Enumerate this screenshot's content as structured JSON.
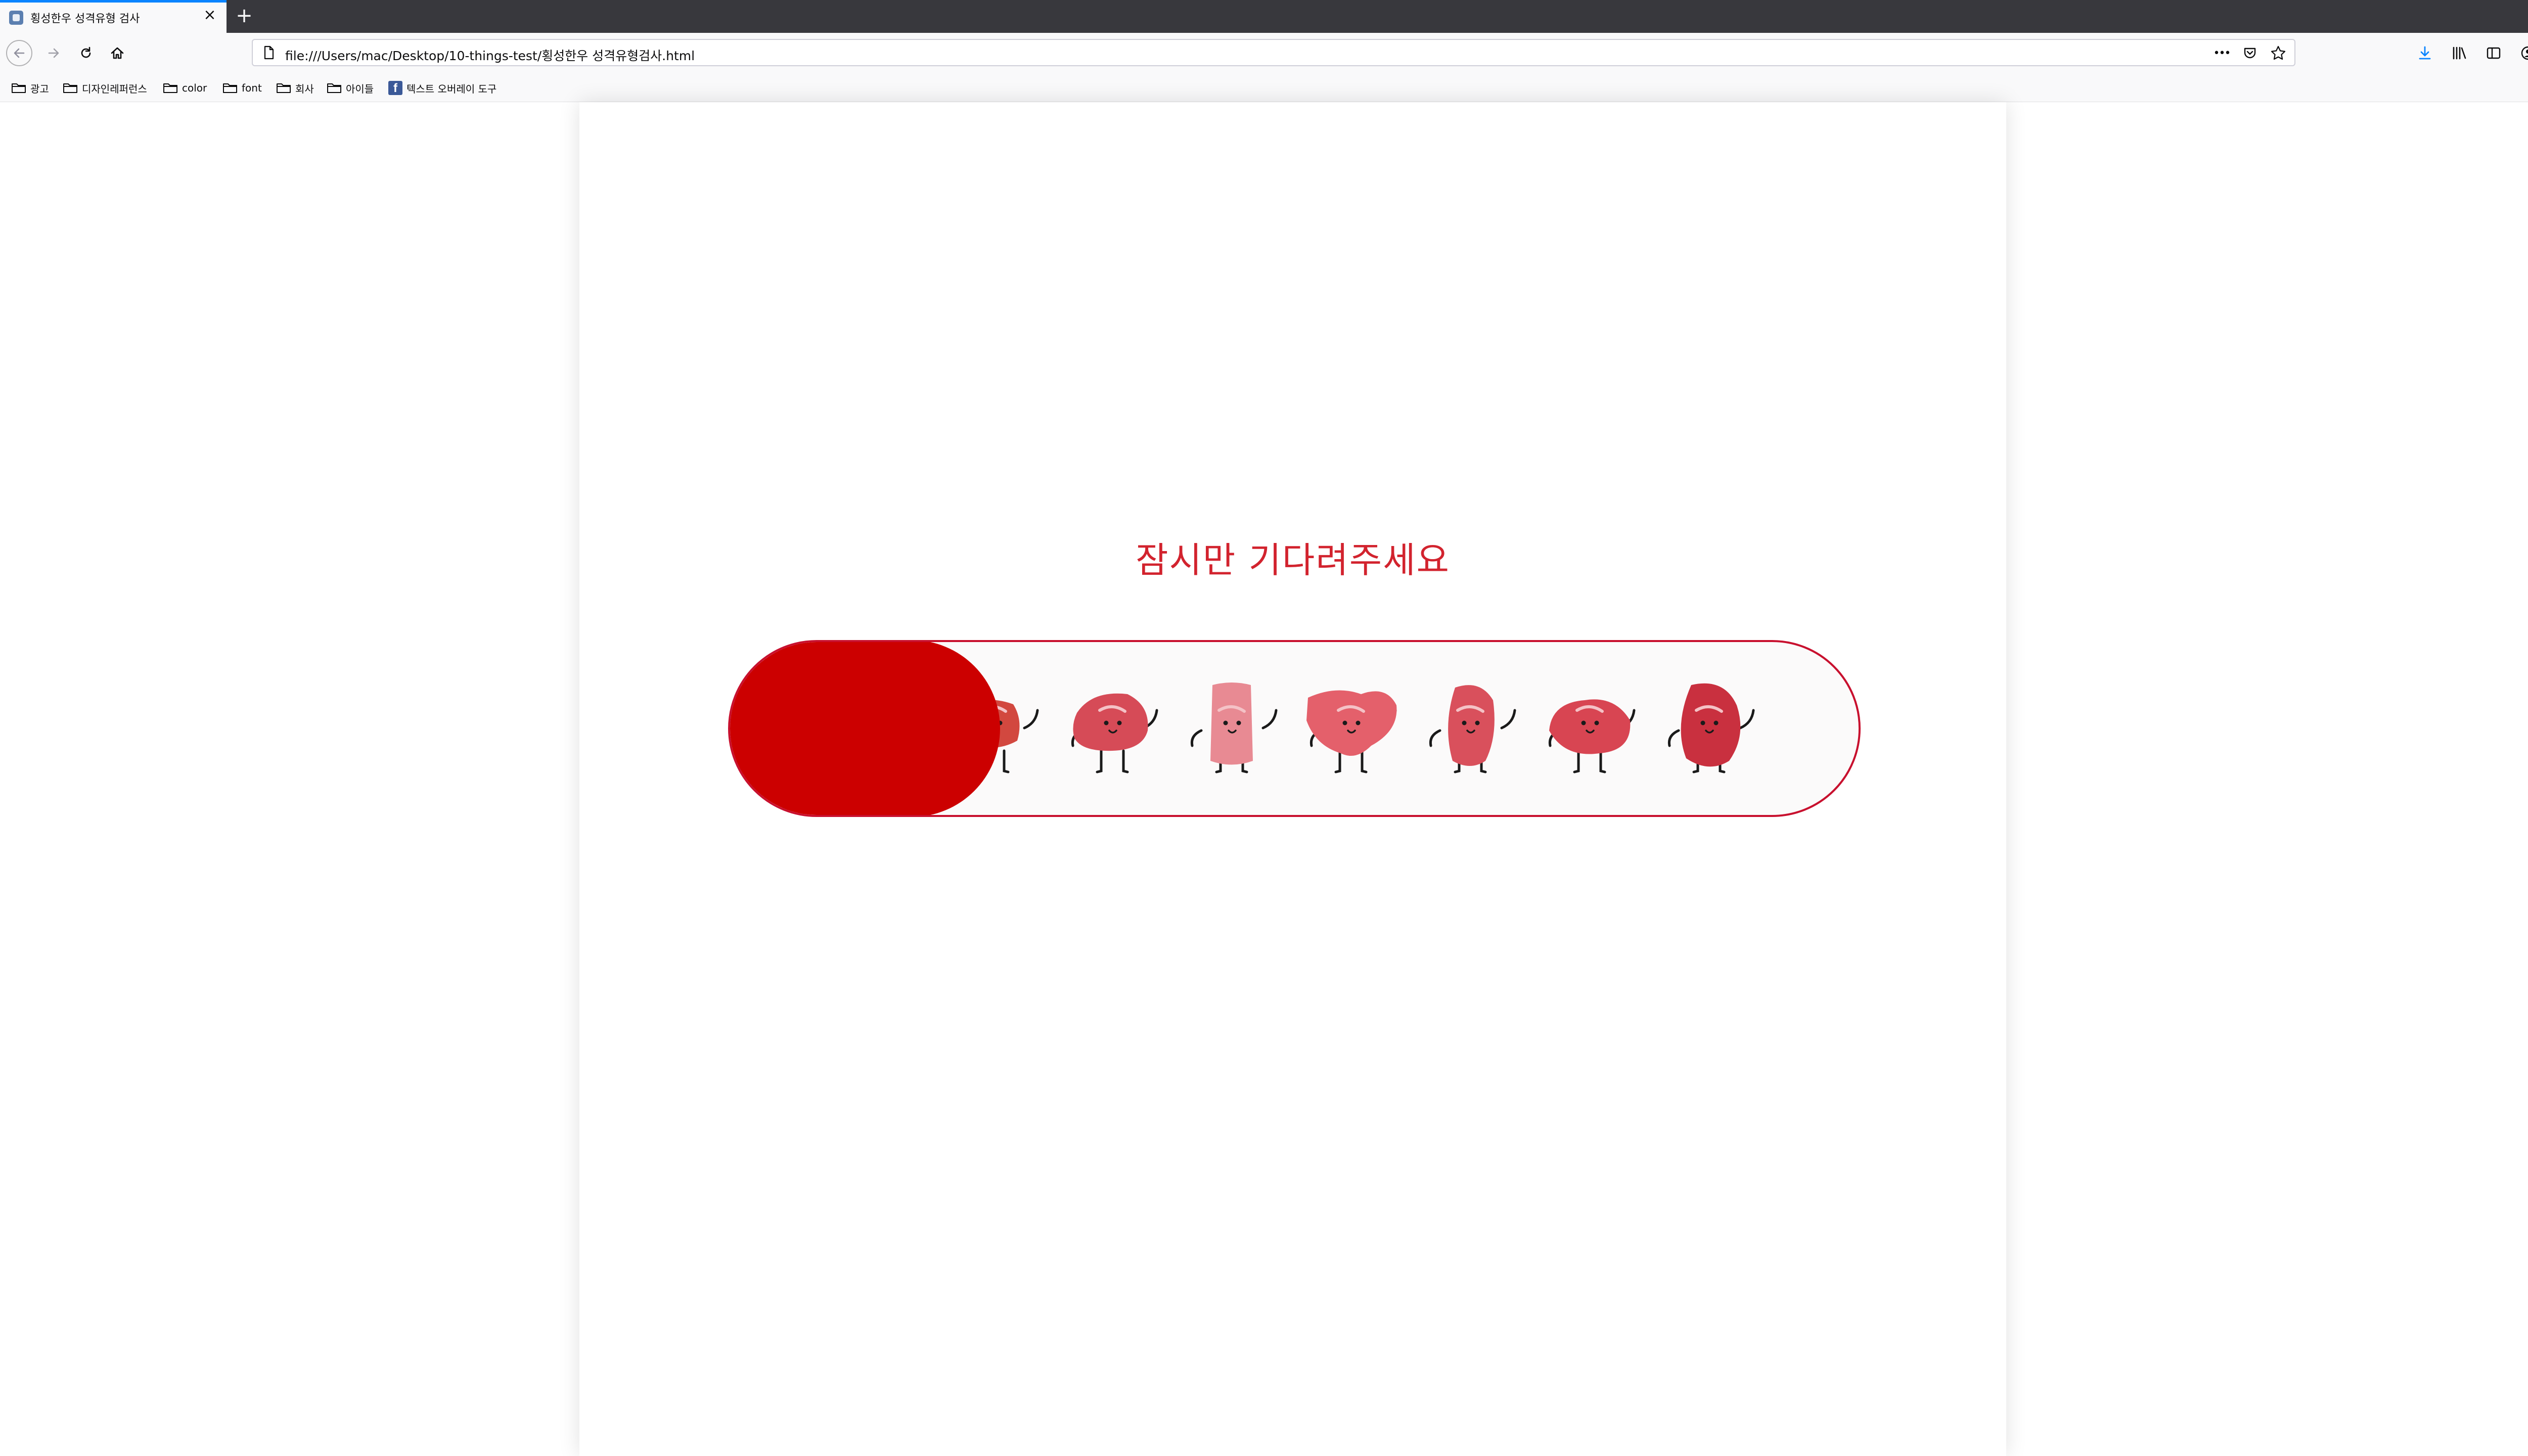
{
  "browser": {
    "tab_title": "횡성한우 성격유형 검사",
    "tab_close": "×",
    "new_tab": "+",
    "url": "file:///Users/mac/Desktop/10-things-test/횡성한우 성격유형검사.html",
    "url_more": "•••"
  },
  "bookmarks": [
    {
      "label": "광고",
      "icon": "folder-icon"
    },
    {
      "label": "디자인레퍼런스",
      "icon": "folder-icon"
    },
    {
      "label": "color",
      "icon": "folder-icon"
    },
    {
      "label": "font",
      "icon": "folder-icon"
    },
    {
      "label": "회사",
      "icon": "folder-icon"
    },
    {
      "label": "아이들",
      "icon": "folder-icon"
    },
    {
      "label": "텍스트 오버레이 도구",
      "icon": "facebook-icon"
    }
  ],
  "page": {
    "loading_text": "잠시만 기다려주세요",
    "progress_fraction": 0.24,
    "colors": {
      "accent": "#cc0000",
      "text": "#d2232e",
      "track_border": "#c8102e"
    },
    "characters": [
      {
        "name": "beef-cut-character-1",
        "body": "#d2483f"
      },
      {
        "name": "beef-cut-character-2",
        "body": "#d64b57"
      },
      {
        "name": "beef-cut-character-3",
        "body": "#e88a93"
      },
      {
        "name": "beef-cut-character-4",
        "body": "#e4606b"
      },
      {
        "name": "beef-cut-character-5",
        "body": "#d9505c"
      },
      {
        "name": "beef-cut-character-6",
        "body": "#d84552"
      },
      {
        "name": "beef-cut-character-7",
        "body": "#c9303f"
      }
    ]
  }
}
